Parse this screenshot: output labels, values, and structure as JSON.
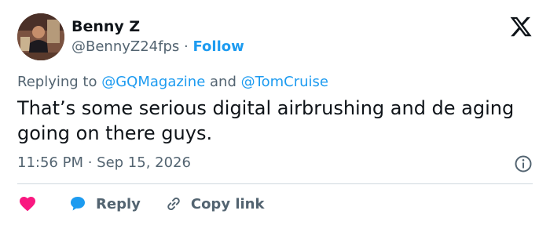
{
  "user": {
    "name": "Benny Z",
    "handle": "@BennyZ24fps",
    "separator": "·",
    "follow_label": "Follow"
  },
  "reply": {
    "prefix": "Replying to",
    "mention1": "@GQMagazine",
    "conjunction": "and",
    "mention2": "@TomCruise"
  },
  "tweet": {
    "text": "That’s some serious digital airbrushing and de aging going on there guys.",
    "timestamp": "11:56 PM · Sep 15, 2026"
  },
  "actions": {
    "reply_label": "Reply",
    "copy_label": "Copy link"
  },
  "colors": {
    "link": "#1d9bf0",
    "like": "#f91880",
    "muted": "#536471"
  },
  "icons": {
    "logo": "x-logo-icon",
    "info": "info-icon",
    "like": "heart-icon",
    "reply": "speech-bubble-icon",
    "copy": "link-icon"
  }
}
